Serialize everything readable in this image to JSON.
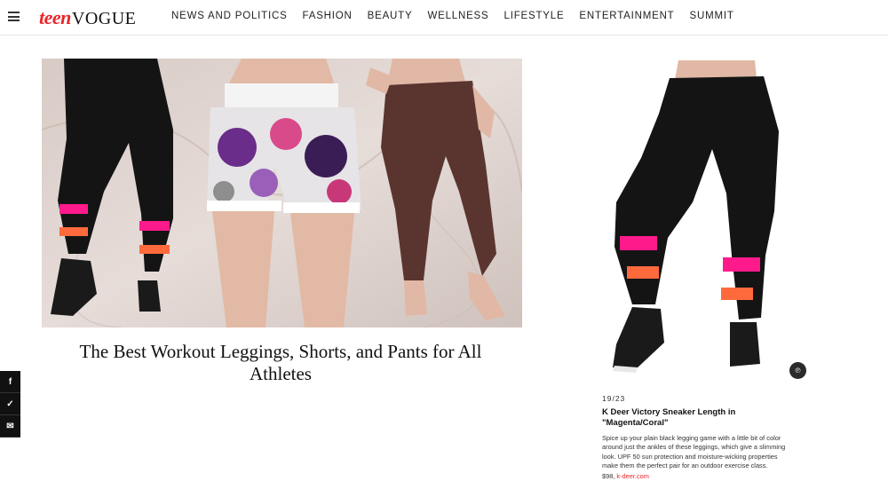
{
  "header": {
    "logo_teen": "teen",
    "logo_vogue": "VOGUE",
    "nav": [
      "NEWS AND POLITICS",
      "FASHION",
      "BEAUTY",
      "WELLNESS",
      "LIFESTYLE",
      "ENTERTAINMENT",
      "SUMMIT"
    ]
  },
  "article": {
    "title": "The Best Workout Leggings, Shorts, and Pants for All Athletes"
  },
  "share": {
    "facebook": "f",
    "twitter": "✓",
    "email": "✉"
  },
  "slide": {
    "counter": "19/23",
    "title": "K Deer Victory Sneaker Length in \"Magenta/Coral\"",
    "description": "Spice up your plain black legging game with a little bit of color around just the ankles of these leggings, which give a slimming look. UPF 50 sun protection and moisture-wicking properties make them the perfect pair for an outdoor exercise class.",
    "price": "$98,",
    "shop": "k-deer.com",
    "pin_icon": "pinterest-icon"
  },
  "colors": {
    "brand_red": "#e8262a",
    "magenta": "#ff1a8c",
    "coral": "#ff6a3d",
    "legging_black": "#141414",
    "brown": "#5a3530"
  }
}
